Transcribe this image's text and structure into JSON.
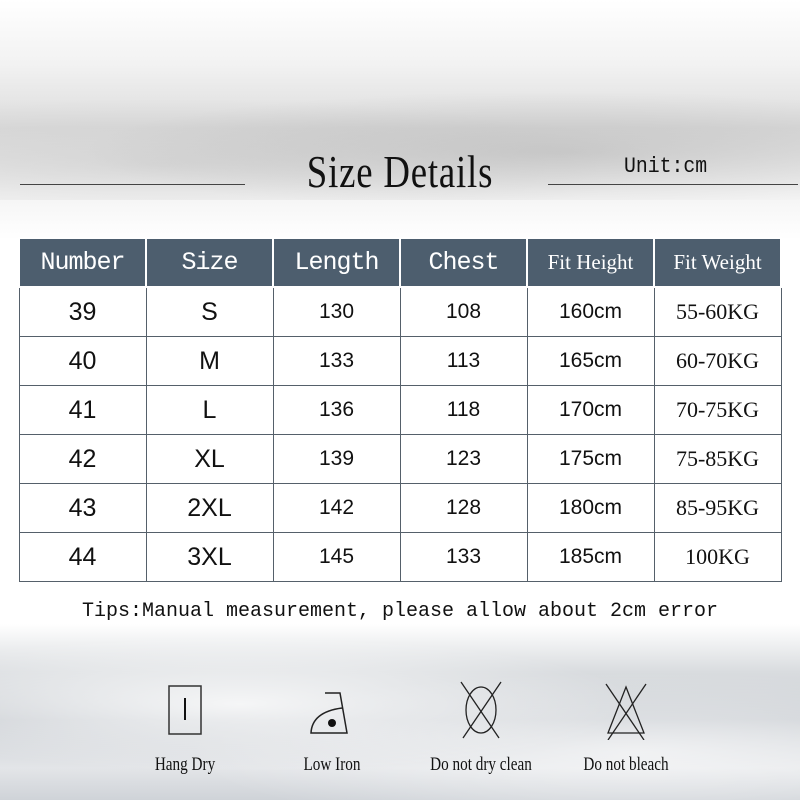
{
  "title": "Size Details",
  "unit": "Unit:cm",
  "table": {
    "headers": [
      "Number",
      "Size",
      "Length",
      "Chest",
      "Fit Height",
      "Fit Weight"
    ],
    "rows": [
      [
        "39",
        "S",
        "130",
        "108",
        "160cm",
        "55-60KG"
      ],
      [
        "40",
        "M",
        "133",
        "113",
        "165cm",
        "60-70KG"
      ],
      [
        "41",
        "L",
        "136",
        "118",
        "170cm",
        "70-75KG"
      ],
      [
        "42",
        "XL",
        "139",
        "123",
        "175cm",
        "75-85KG"
      ],
      [
        "43",
        "2XL",
        "142",
        "128",
        "180cm",
        "85-95KG"
      ],
      [
        "44",
        "3XL",
        "145",
        "133",
        "185cm",
        "100KG"
      ]
    ]
  },
  "tips": "Tips:Manual measurement, please allow about 2cm error",
  "care": [
    {
      "icon": "hang-dry-icon",
      "label": "Hang Dry"
    },
    {
      "icon": "low-iron-icon",
      "label": "Low Iron"
    },
    {
      "icon": "no-dry-clean-icon",
      "label": "Do not dry clean"
    },
    {
      "icon": "no-bleach-icon",
      "label": "Do not bleach"
    }
  ],
  "colors": {
    "header": "#4d5e6e"
  }
}
